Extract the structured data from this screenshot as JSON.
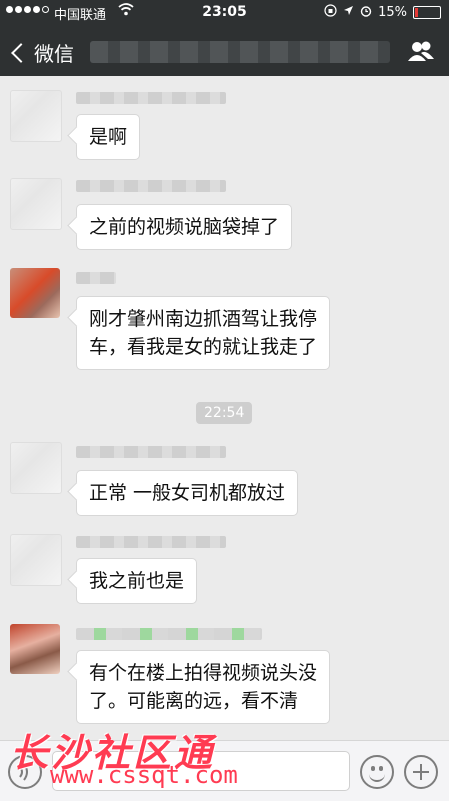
{
  "statusbar": {
    "carrier": "中国联通",
    "time": "23:05",
    "battery": "15%",
    "battery_level": 0.15
  },
  "nav": {
    "back_label": "微信"
  },
  "messages": [
    {
      "text": "是啊"
    },
    {
      "text": "之前的视频说脑袋掉了"
    },
    {
      "line1": "刚才肇州南边抓酒驾让我停",
      "line2": "车，看我是女的就让我走了"
    },
    {
      "text": "正常 一般女司机都放过"
    },
    {
      "text": "我之前也是"
    },
    {
      "line1": "有个在楼上拍得视频说头没",
      "line2": "了。可能离的远，看不清"
    }
  ],
  "timestamp": "22:54",
  "watermark": {
    "name": "长沙社区通",
    "url": "www.cssqt.com"
  }
}
